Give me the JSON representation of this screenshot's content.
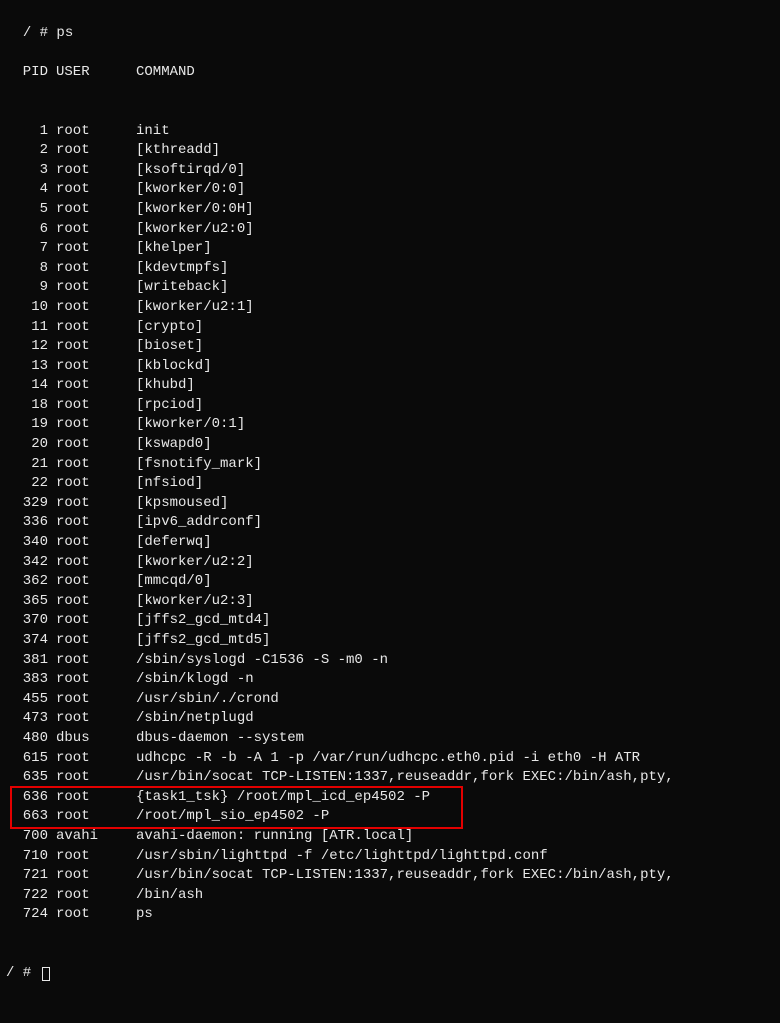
{
  "prompt1": "/ # ps",
  "prompt2": "/ # ",
  "headers": {
    "pid": "PID",
    "user": "USER",
    "command": "COMMAND"
  },
  "processes": [
    {
      "pid": "1",
      "user": "root",
      "command": "init"
    },
    {
      "pid": "2",
      "user": "root",
      "command": "[kthreadd]"
    },
    {
      "pid": "3",
      "user": "root",
      "command": "[ksoftirqd/0]"
    },
    {
      "pid": "4",
      "user": "root",
      "command": "[kworker/0:0]"
    },
    {
      "pid": "5",
      "user": "root",
      "command": "[kworker/0:0H]"
    },
    {
      "pid": "6",
      "user": "root",
      "command": "[kworker/u2:0]"
    },
    {
      "pid": "7",
      "user": "root",
      "command": "[khelper]"
    },
    {
      "pid": "8",
      "user": "root",
      "command": "[kdevtmpfs]"
    },
    {
      "pid": "9",
      "user": "root",
      "command": "[writeback]"
    },
    {
      "pid": "10",
      "user": "root",
      "command": "[kworker/u2:1]"
    },
    {
      "pid": "11",
      "user": "root",
      "command": "[crypto]"
    },
    {
      "pid": "12",
      "user": "root",
      "command": "[bioset]"
    },
    {
      "pid": "13",
      "user": "root",
      "command": "[kblockd]"
    },
    {
      "pid": "14",
      "user": "root",
      "command": "[khubd]"
    },
    {
      "pid": "18",
      "user": "root",
      "command": "[rpciod]"
    },
    {
      "pid": "19",
      "user": "root",
      "command": "[kworker/0:1]"
    },
    {
      "pid": "20",
      "user": "root",
      "command": "[kswapd0]"
    },
    {
      "pid": "21",
      "user": "root",
      "command": "[fsnotify_mark]"
    },
    {
      "pid": "22",
      "user": "root",
      "command": "[nfsiod]"
    },
    {
      "pid": "329",
      "user": "root",
      "command": "[kpsmoused]"
    },
    {
      "pid": "336",
      "user": "root",
      "command": "[ipv6_addrconf]"
    },
    {
      "pid": "340",
      "user": "root",
      "command": "[deferwq]"
    },
    {
      "pid": "342",
      "user": "root",
      "command": "[kworker/u2:2]"
    },
    {
      "pid": "362",
      "user": "root",
      "command": "[mmcqd/0]"
    },
    {
      "pid": "365",
      "user": "root",
      "command": "[kworker/u2:3]"
    },
    {
      "pid": "370",
      "user": "root",
      "command": "[jffs2_gcd_mtd4]"
    },
    {
      "pid": "374",
      "user": "root",
      "command": "[jffs2_gcd_mtd5]"
    },
    {
      "pid": "381",
      "user": "root",
      "command": "/sbin/syslogd -C1536 -S -m0 -n"
    },
    {
      "pid": "383",
      "user": "root",
      "command": "/sbin/klogd -n"
    },
    {
      "pid": "455",
      "user": "root",
      "command": "/usr/sbin/./crond"
    },
    {
      "pid": "473",
      "user": "root",
      "command": "/sbin/netplugd"
    },
    {
      "pid": "480",
      "user": "dbus",
      "command": "dbus-daemon --system"
    },
    {
      "pid": "615",
      "user": "root",
      "command": "udhcpc -R -b -A 1 -p /var/run/udhcpc.eth0.pid -i eth0 -H ATR"
    },
    {
      "pid": "635",
      "user": "root",
      "command": "/usr/bin/socat TCP-LISTEN:1337,reuseaddr,fork EXEC:/bin/ash,pty,"
    },
    {
      "pid": "636",
      "user": "root",
      "command": "{task1_tsk} /root/mpl_icd_ep4502 -P"
    },
    {
      "pid": "663",
      "user": "root",
      "command": "/root/mpl_sio_ep4502 -P"
    },
    {
      "pid": "700",
      "user": "avahi",
      "command": "avahi-daemon: running [ATR.local]"
    },
    {
      "pid": "710",
      "user": "root",
      "command": "/usr/sbin/lighttpd -f /etc/lighttpd/lighttpd.conf"
    },
    {
      "pid": "721",
      "user": "root",
      "command": "/usr/bin/socat TCP-LISTEN:1337,reuseaddr,fork EXEC:/bin/ash,pty,"
    },
    {
      "pid": "722",
      "user": "root",
      "command": "/bin/ash"
    },
    {
      "pid": "724",
      "user": "root",
      "command": "ps"
    }
  ],
  "highlight": {
    "start_index": 34,
    "end_index": 35
  }
}
